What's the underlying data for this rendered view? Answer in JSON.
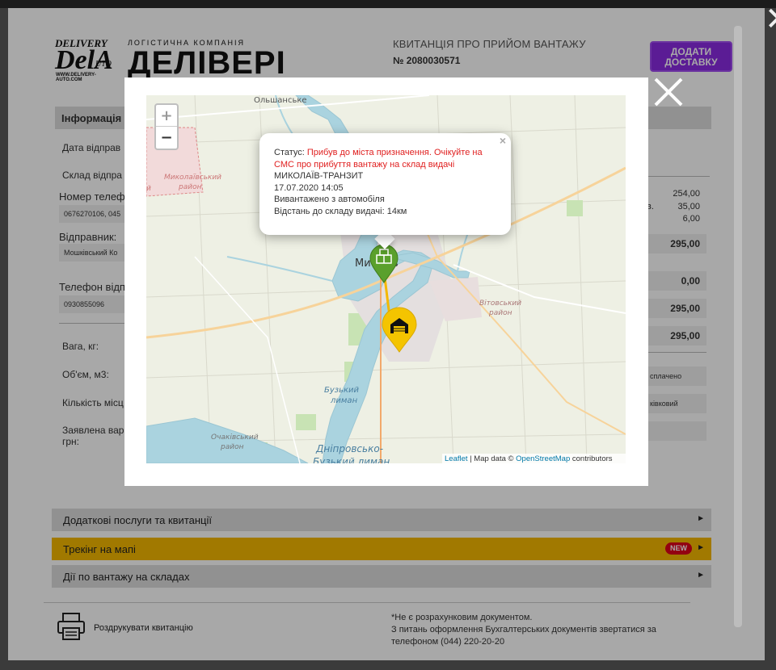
{
  "receipt": {
    "brand_delivery": "DELIVERY",
    "brand_dela": "DelA",
    "brand_auto": "UTO",
    "brand_url": "WWW.DELIVERY-AUTO.COM",
    "brand_tagline": "ЛОГІСТИЧНА КОМПАНІЯ",
    "brand_name": "ДЕЛІВЕРІ",
    "title": "КВИТАНЦІЯ ПРО ПРИЙОМ ВАНТАЖУ",
    "number": "№ 2080030571",
    "add_button": "ДОДАТИ ДОСТАВКУ",
    "info_header": "Інформація",
    "labels": {
      "send_date": "Дата відправ",
      "warehouse": "Склад відпра",
      "phone": "Номер телеф",
      "sender": "Відправник:",
      "recipient_phone": "Телефон відп",
      "weight": "Вага, кг:",
      "volume": "Об'єм, м3:",
      "places": "Кількість місц",
      "declared_1": "Заявлена вар",
      "declared_2": "грн:"
    },
    "values": {
      "phone": "0676270106, 045",
      "sender": "Мошківський Ко",
      "recipient_phone": "0930855096"
    },
    "amounts": {
      "a1": "254,00",
      "a2": "35,00",
      "a3": "6,00",
      "a2_prefix": "в.",
      "total1": "295,00",
      "zero": "0,00",
      "total2": "295,00",
      "total3": "295,00"
    },
    "payment_status": "сплачено",
    "payment_type": "ківковий",
    "accordion": {
      "extra_services": "Додаткові послуги та квитанції",
      "tracking": "Трекінг на мапі",
      "tracking_badge": "NEW",
      "warehouse_actions": "Дії по вантажу на складах",
      "arrow": "►"
    },
    "print_label": "Роздрукувати квитанцію",
    "footnote_1": "*Не є розрахунковим документом.",
    "footnote_2": "З питань оформлення Бухгалтерських документів звертатися за",
    "footnote_3": "телефоном (044) 220-20-20"
  },
  "map": {
    "zoom_in": "+",
    "zoom_out": "−",
    "popup": {
      "status_label": "Статус: ",
      "status_value": "Прибув до міста призначення. Очікуйте на СМС про прибуття вантажу на склад видачі",
      "terminal": "МИКОЛАЇВ-ТРАНЗИТ",
      "datetime": "17.07.2020 14:05",
      "event": "Вивантажено з автомобіля",
      "distance": "Відстань до складу видачі: 14км",
      "close": "×"
    },
    "places": {
      "olshanske": "Ольшанське",
      "mykolaiv_raion_1": "Миколаївський",
      "mykolaiv_raion_2": "район",
      "raion_left": "й",
      "city_left": "Ми",
      "city_right": "в",
      "vitovsky_1": "Вітовський",
      "vitovsky_2": "район",
      "buzky_1": "Бузький",
      "buzky_2": "лиман",
      "ochakiv_1": "Очаківський",
      "ochakiv_2": "район",
      "dniprovsko_1": "Дніпровсько-",
      "dniprovsko_2": "Бузький лиман"
    },
    "attribution_leaflet": "Leaflet",
    "attribution_text": " | Map data © ",
    "attribution_osm": "OpenStreetMap",
    "attribution_end": " contributors"
  },
  "colors": {
    "accent_purple": "#8a2be2",
    "tracking_yellow": "#f4b800",
    "status_red": "#e02020",
    "marker_green": "#5aa02c",
    "marker_yellow": "#f4c400"
  }
}
